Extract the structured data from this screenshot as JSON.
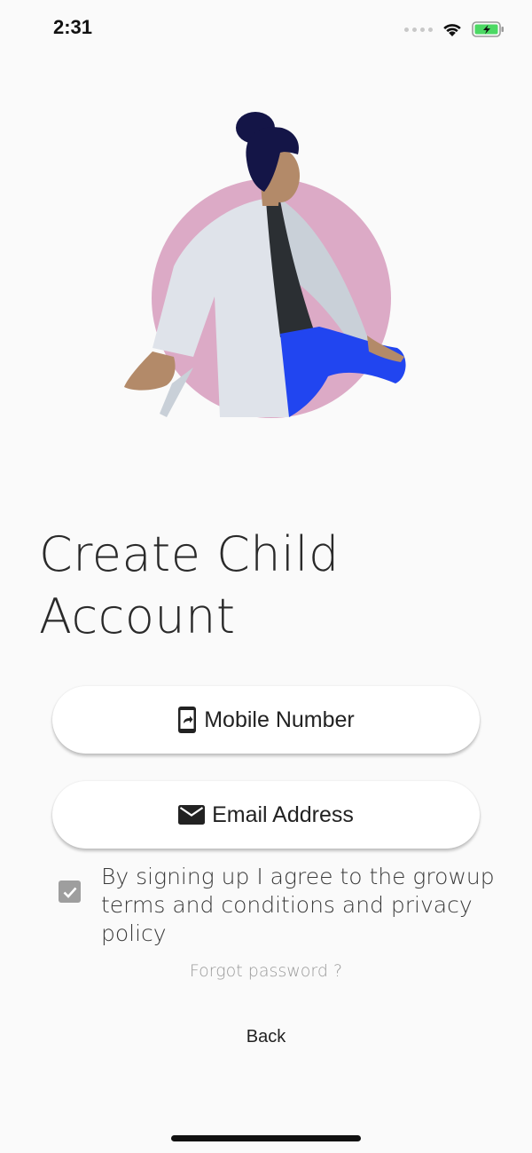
{
  "status_bar": {
    "time": "2:31",
    "icons": [
      "signal-dots-icon",
      "wifi-icon",
      "battery-charging-icon"
    ]
  },
  "illustration": {
    "name": "person-sitting-illustration",
    "colors": {
      "circle": "#dcaac6",
      "hair": "#141547",
      "skin": "#b38a69",
      "coat": "#dfe3ea",
      "shirt": "#2b2f33",
      "pants": "#2145f0"
    }
  },
  "page": {
    "title": "Create Child Account"
  },
  "buttons": {
    "mobile": {
      "label": "Mobile Number",
      "icon": "mobile-phone-icon"
    },
    "email": {
      "label": "Email Address",
      "icon": "email-envelope-icon"
    }
  },
  "terms": {
    "checked": true,
    "text": "By signing up I agree to the growup terms and conditions and privacy policy"
  },
  "links": {
    "forgot_password": "Forgot password ?",
    "back": "Back"
  }
}
